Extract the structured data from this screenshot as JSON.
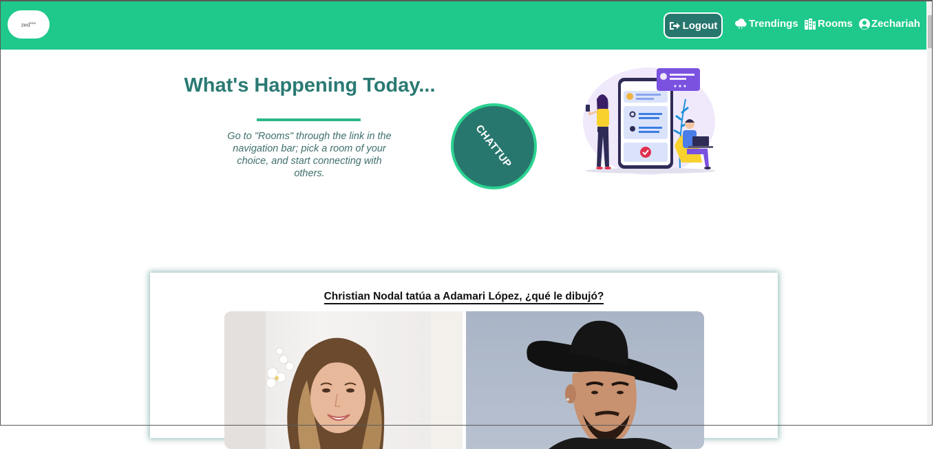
{
  "navbar": {
    "logo_text": "zed",
    "logo_sup": "tex",
    "logout_label": "Logout",
    "links": [
      {
        "label": "Trendings",
        "icon": "cloud-icon"
      },
      {
        "label": "Rooms",
        "icon": "building-icon"
      },
      {
        "label": "Zechariah",
        "icon": "user-circle-icon"
      }
    ]
  },
  "hero": {
    "title": "What's Happening Today...",
    "description": "Go to \"Rooms\" through the link in the navigation bar; pick a room of your choice, and start connecting with others.",
    "badge_text": "CHATTUP"
  },
  "news": {
    "headline": "Christian Nodal tatúa a Adamari López, ¿qué le dibujó?"
  },
  "colors": {
    "accent": "#1ec98b",
    "teal": "#28776e",
    "title": "#2a7a73"
  }
}
